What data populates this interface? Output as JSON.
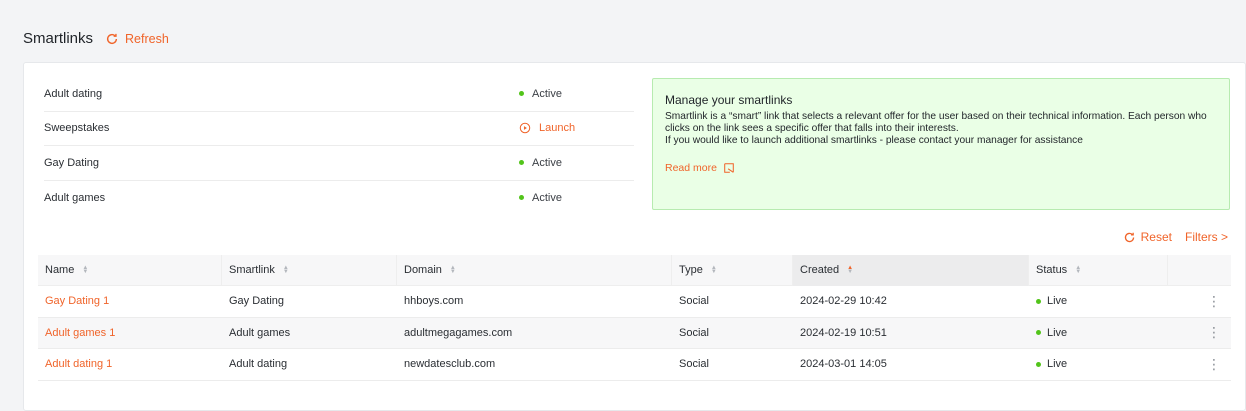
{
  "header": {
    "title": "Smartlinks",
    "refresh_label": "Refresh"
  },
  "smartlinks": [
    {
      "name": "Adult dating",
      "status": "Active",
      "state": "active"
    },
    {
      "name": "Sweepstakes",
      "status": "Launch",
      "state": "launch"
    },
    {
      "name": "Gay Dating",
      "status": "Active",
      "state": "active"
    },
    {
      "name": "Adult games",
      "status": "Active",
      "state": "active"
    }
  ],
  "info": {
    "title": "Manage your smartlinks",
    "line1": "Smartlink is a “smart” link that selects a relevant offer for the user based on their technical information. Each person who clicks on the link sees a specific offer that falls into their interests.",
    "line2": "If you would like to launch additional smartlinks - please contact your manager for assistance",
    "read_more": "Read more"
  },
  "actions": {
    "reset": "Reset",
    "filters": "Filters >"
  },
  "table": {
    "columns": [
      "Name",
      "Smartlink",
      "Domain",
      "Type",
      "Created",
      "Status"
    ],
    "rows": [
      {
        "name": "Gay Dating 1",
        "smartlink": "Gay Dating",
        "domain": "hhboys.com",
        "type": "Social",
        "created": "2024-02-29 10:42",
        "status": "Live"
      },
      {
        "name": "Adult games 1",
        "smartlink": "Adult games",
        "domain": "adultmegagames.com",
        "type": "Social",
        "created": "2024-02-19 10:51",
        "status": "Live"
      },
      {
        "name": "Adult dating 1",
        "smartlink": "Adult dating",
        "domain": "newdatesclub.com",
        "type": "Social",
        "created": "2024-03-01 14:05",
        "status": "Live"
      }
    ]
  },
  "colors": {
    "accent": "#f0642a",
    "live": "#52c41a",
    "info_bg": "#eaffe6"
  }
}
